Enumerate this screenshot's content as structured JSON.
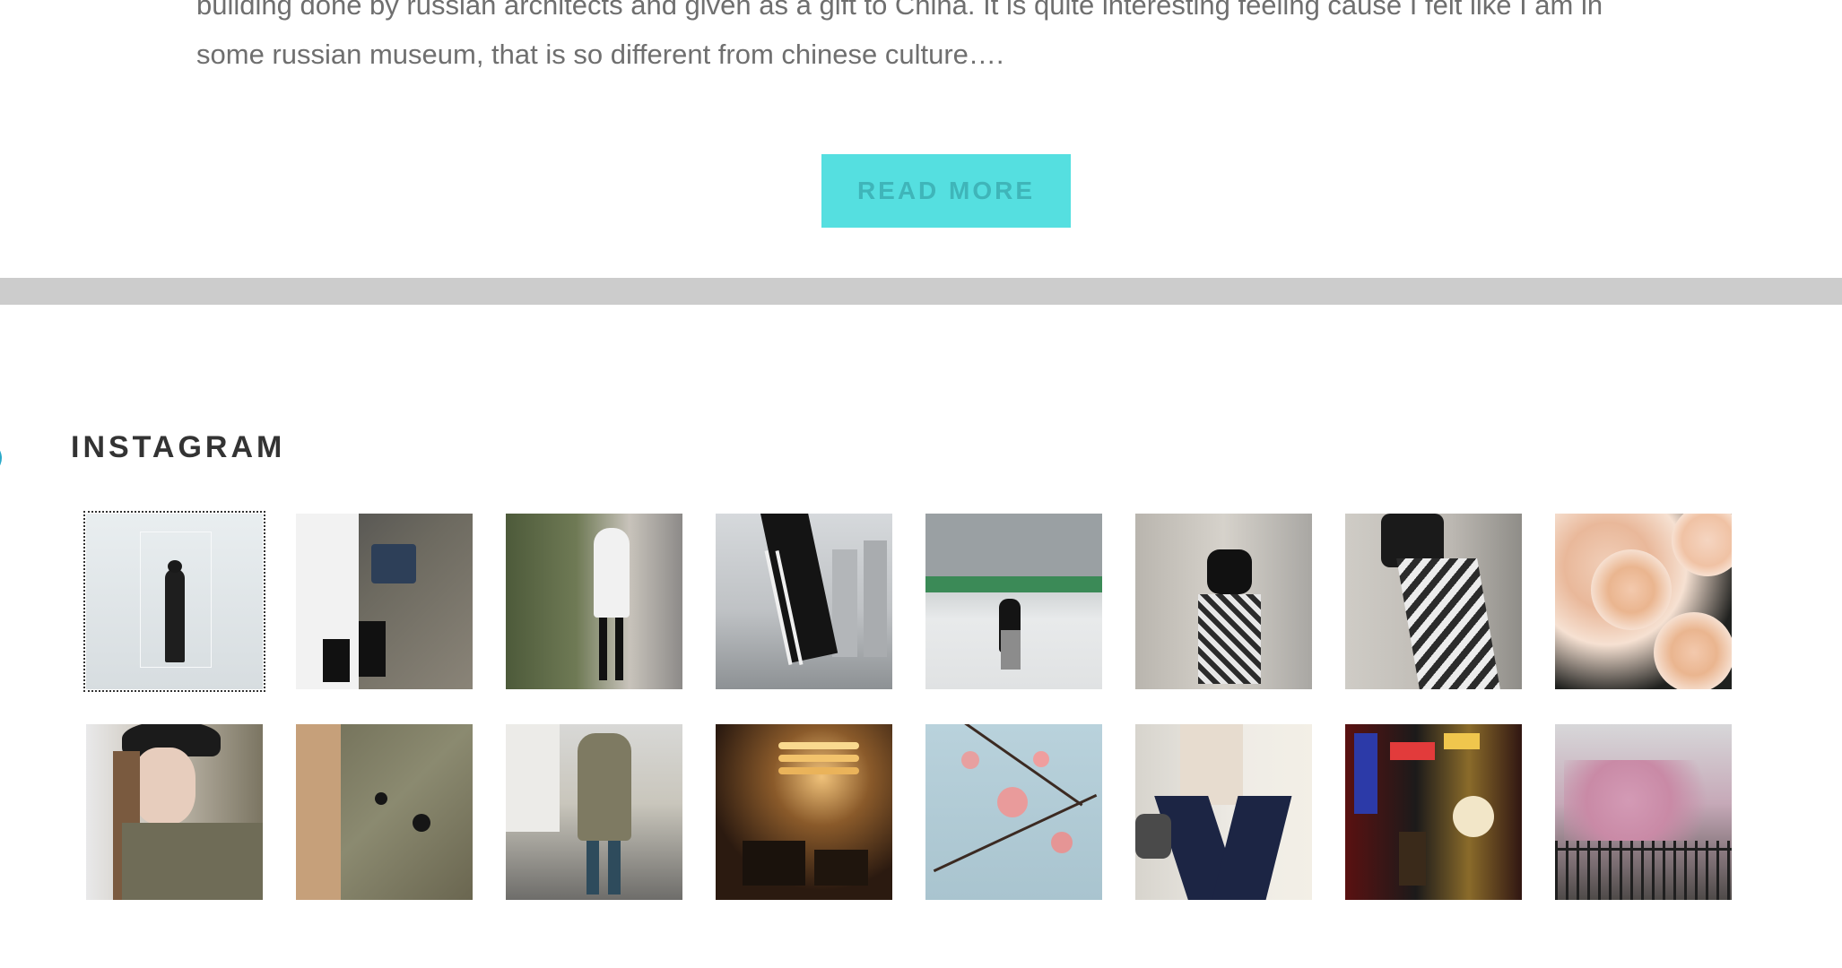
{
  "post": {
    "excerpt_line1": "building done by russian architects and given as a gift to China. It is quite interesting feeling cause I felt like I am in",
    "excerpt_line2": "some russian museum, that is so different from chinese culture….",
    "read_more_label": "READ MORE"
  },
  "colors": {
    "accent": "#55dfe0",
    "divider": "#cccccc",
    "text": "#6f6f6f",
    "heading": "#333333"
  },
  "instagram": {
    "heading": "INSTAGRAM",
    "photos": [
      {
        "name": "woman-in-white-corridor"
      },
      {
        "name": "shoes-and-blue-bag"
      },
      {
        "name": "woman-with-white-coat-street"
      },
      {
        "name": "legs-with-striped-pants-city"
      },
      {
        "name": "bund-building-square"
      },
      {
        "name": "floral-dress-street"
      },
      {
        "name": "floral-pants-walking"
      },
      {
        "name": "peach-roses"
      },
      {
        "name": "woman-with-beret-portrait"
      },
      {
        "name": "olive-jacket-closeup"
      },
      {
        "name": "trench-coat-walking"
      },
      {
        "name": "cafe-interior-lights"
      },
      {
        "name": "cherry-blossoms-sky"
      },
      {
        "name": "wide-navy-trousers"
      },
      {
        "name": "neon-signs-street"
      },
      {
        "name": "pink-magnolia-fence"
      }
    ]
  }
}
